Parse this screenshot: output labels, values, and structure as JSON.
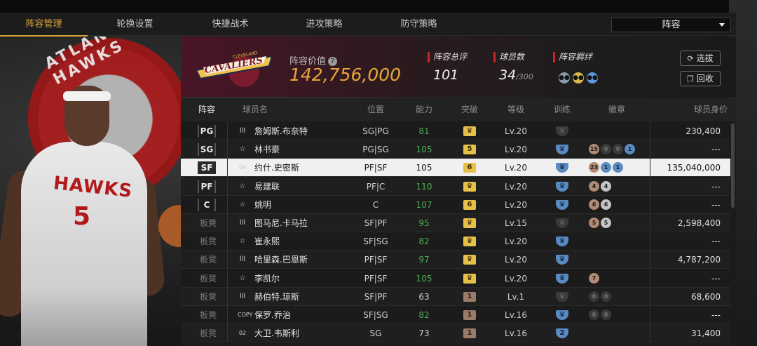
{
  "tabs": [
    {
      "label": "阵容管理",
      "active": true
    },
    {
      "label": "轮换设置",
      "active": false
    },
    {
      "label": "快捷战术",
      "active": false
    },
    {
      "label": "进攻策略",
      "active": false
    },
    {
      "label": "防守策略",
      "active": false
    }
  ],
  "lineup_select": {
    "value": "阵容"
  },
  "hero": {
    "team_watermark": "ATLANTA HAWKS",
    "jersey_name": "HAWKS",
    "jersey_number": "5"
  },
  "team": {
    "logo_text": "CAVALIERS",
    "logo_subtext": "CLEVELAND",
    "value_label": "阵容价值",
    "value": "142,756,000",
    "rating_label": "阵容总评",
    "rating": "101",
    "players_label": "球员数",
    "players_count": "34",
    "players_max": "/300",
    "bond_label": "阵容羁绊"
  },
  "buttons": {
    "recruit": "选拔",
    "recycle": "回收"
  },
  "table": {
    "headers": [
      "阵容",
      "球员名",
      "位置",
      "能力",
      "突破",
      "等级",
      "训练",
      "徽章",
      "球员身价"
    ],
    "rows": [
      {
        "slot": "PG",
        "tier": "lll",
        "name": "詹姆斯.布奈特",
        "pos": "SG|PG",
        "ability": "81",
        "green": true,
        "breakthrough": "",
        "level": "Lv.20",
        "train": "grey",
        "badges": [],
        "worth": "230,400"
      },
      {
        "slot": "SG",
        "tier": "☆",
        "name": "林书豪",
        "pos": "PG|SG",
        "ability": "105",
        "green": true,
        "breakthrough": "5",
        "level": "Lv.20",
        "train": "blue",
        "badges": [
          "15",
          "0",
          "0",
          "1"
        ],
        "worth": "---"
      },
      {
        "slot": "SF",
        "tier": "09",
        "name": "约什.史密斯",
        "pos": "PF|SF",
        "ability": "105",
        "green": false,
        "breakthrough": "6",
        "level": "Lv.20",
        "train": "blue",
        "badges": [
          "23",
          "1",
          "1"
        ],
        "worth": "135,040,000"
      },
      {
        "slot": "PF",
        "tier": "☆",
        "name": "易建联",
        "pos": "PF|C",
        "ability": "110",
        "green": true,
        "breakthrough": "",
        "level": "Lv.20",
        "train": "blue",
        "badges": [
          "4",
          "4"
        ],
        "worth": "---"
      },
      {
        "slot": "C",
        "tier": "☆",
        "name": "姚明",
        "pos": "C",
        "ability": "107",
        "green": true,
        "breakthrough": "6",
        "level": "Lv.20",
        "train": "blue",
        "badges": [
          "6",
          "6"
        ],
        "worth": "---"
      },
      {
        "slot": "板凳",
        "tier": "lll",
        "name": "图马尼.卡马拉",
        "pos": "SF|PF",
        "ability": "95",
        "green": true,
        "breakthrough": "",
        "level": "Lv.15",
        "train": "grey",
        "badges": [
          "5",
          "5"
        ],
        "worth": "2,598,400"
      },
      {
        "slot": "板凳",
        "tier": "☆",
        "name": "崔永熙",
        "pos": "SF|SG",
        "ability": "82",
        "green": true,
        "breakthrough": "",
        "level": "Lv.20",
        "train": "blue",
        "badges": [],
        "worth": "---"
      },
      {
        "slot": "板凳",
        "tier": "lll",
        "name": "哈里森.巴恩斯",
        "pos": "PF|SF",
        "ability": "97",
        "green": true,
        "breakthrough": "",
        "level": "Lv.20",
        "train": "blue",
        "badges": [],
        "worth": "4,787,200"
      },
      {
        "slot": "板凳",
        "tier": "☆",
        "name": "李凯尔",
        "pos": "PF|SF",
        "ability": "105",
        "green": true,
        "breakthrough": "",
        "level": "Lv.20",
        "train": "blue",
        "badges": [
          "7"
        ],
        "worth": "---"
      },
      {
        "slot": "板凳",
        "tier": "lll",
        "name": "赫伯特.琼斯",
        "pos": "SF|PF",
        "ability": "63",
        "green": false,
        "breakthrough": "1",
        "level": "Lv.1",
        "train": "grey",
        "badges": [
          "0",
          "0"
        ],
        "worth": "68,600"
      },
      {
        "slot": "板凳",
        "tier": "COPY",
        "name": "保罗.乔治",
        "pos": "SF|SG",
        "ability": "82",
        "green": true,
        "breakthrough": "1",
        "level": "Lv.16",
        "train": "blue",
        "badges": [
          "0",
          "0"
        ],
        "worth": "---"
      },
      {
        "slot": "板凳",
        "tier": "02",
        "name": "大卫.韦斯利",
        "pos": "SG",
        "ability": "73",
        "green": false,
        "breakthrough": "1",
        "level": "Lv.16",
        "train": "blue2",
        "badges": [],
        "worth": "31,400"
      }
    ]
  },
  "colors": {
    "accent": "#e0a43a",
    "red": "#c62828",
    "green": "#4caf50",
    "badge_gold": "#e6c14a",
    "train_blue": "#5a8ac2"
  }
}
